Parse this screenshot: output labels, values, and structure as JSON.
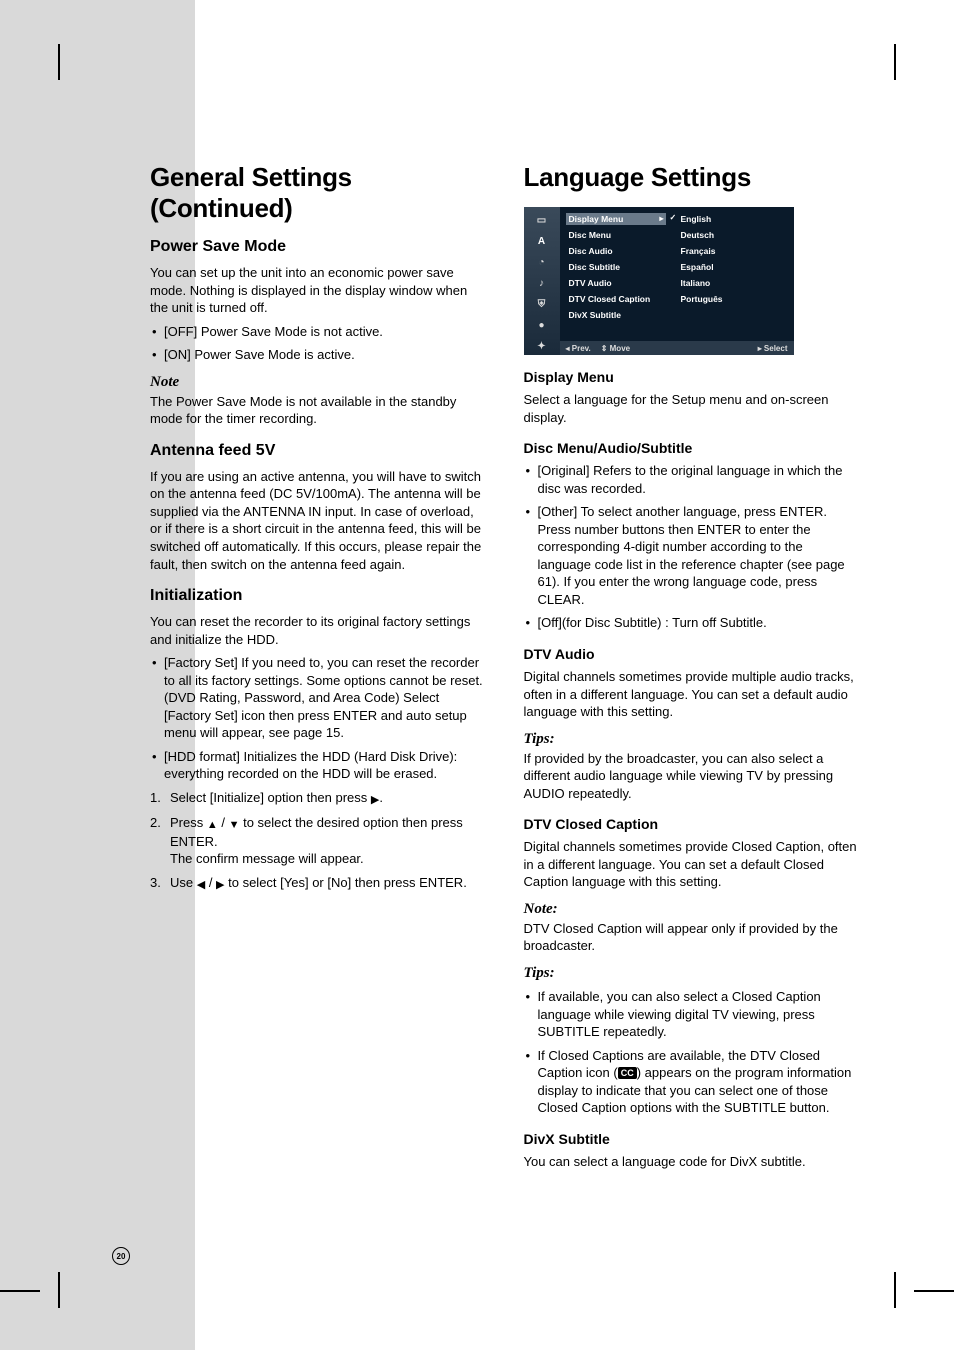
{
  "page_number": "20",
  "left": {
    "title": "General Settings (Continued)",
    "power_save": {
      "heading": "Power Save Mode",
      "intro": "You can set up the unit into an economic power save mode. Nothing is displayed in the display window when the unit is turned off.",
      "off": "[OFF] Power Save Mode is not active.",
      "on": "[ON] Power Save Mode is active.",
      "note_label": "Note",
      "note_body": "The Power Save Mode is not available in the standby mode for the timer recording."
    },
    "antenna": {
      "heading": "Antenna feed 5V",
      "body": "If you are using an active antenna, you will have to switch on the antenna feed (DC 5V/100mA). The antenna will be supplied via the ANTENNA IN input. In case of overload, or if there is a short circuit in the antenna feed, this will be switched off automatically. If this occurs, please repair the fault, then switch on the antenna feed again."
    },
    "init": {
      "heading": "Initialization",
      "intro": "You can reset the recorder to its original factory settings and initialize the HDD.",
      "factory": "[Factory Set] If you need to, you can reset the recorder to all its factory settings. Some options cannot be reset. (DVD Rating, Password, and Area Code) Select [Factory Set] icon then press ENTER and auto setup menu will appear, see page 15.",
      "hdd": "[HDD format] Initializes the HDD (Hard Disk Drive): everything recorded on the HDD will be erased.",
      "step1_pre": "Select [Initialize] option then press ",
      "step1_post": ".",
      "step2_pre": "Press ",
      "step2_mid": " / ",
      "step2_post": " to select the desired option then press ENTER.",
      "step2_line2": "The confirm message will appear.",
      "step3_pre": "Use ",
      "step3_mid": " / ",
      "step3_post": " to select [Yes] or [No] then press ENTER."
    }
  },
  "right": {
    "title": "Language Settings",
    "osd": {
      "menu": [
        "Display Menu",
        "Disc Menu",
        "Disc Audio",
        "Disc Subtitle",
        "DTV Audio",
        "DTV Closed Caption",
        "DivX Subtitle"
      ],
      "langs": [
        "English",
        "Deutsch",
        "Français",
        "Español",
        "Italiano",
        "Português"
      ],
      "footer_prev": "◂ Prev.",
      "footer_move": "⇕ Move",
      "footer_select": "▸ Select"
    },
    "display_menu": {
      "heading": "Display Menu",
      "body": "Select a language for the Setup menu and on-screen display."
    },
    "disc": {
      "heading": "Disc Menu/Audio/Subtitle",
      "original": "[Original] Refers to the original language in which the disc was recorded.",
      "other": "[Other] To select another language, press ENTER. Press number buttons then ENTER to enter the corresponding 4-digit number according to the language code list in the reference chapter (see page 61). If you enter the wrong language code, press CLEAR.",
      "off": "[Off](for Disc Subtitle) : Turn off Subtitle."
    },
    "dtv_audio": {
      "heading": "DTV Audio",
      "body": "Digital channels sometimes provide multiple audio tracks, often in a different language. You can set a default audio language with this setting.",
      "tips_label": "Tips:",
      "tips_body": "If provided by the broadcaster, you can also select a different audio language while viewing TV by pressing AUDIO repeatedly."
    },
    "dtv_cc": {
      "heading": "DTV Closed Caption",
      "body": "Digital channels sometimes provide Closed Caption, often in a different language. You can set a default Closed Caption language with this setting.",
      "note_label": "Note:",
      "note_body": "DTV Closed Caption will appear only if provided by the broadcaster.",
      "tips_label": "Tips:",
      "tip1": "If available, you can also select a Closed Caption language while viewing digital TV viewing, press SUBTITLE repeatedly.",
      "tip2_pre": "If Closed Captions are available, the DTV Closed Caption icon (",
      "tip2_cc": "CC",
      "tip2_post": ") appears on the program information display to indicate that you can select one of those Closed Caption options with the SUBTITLE button."
    },
    "divx": {
      "heading": "DivX Subtitle",
      "body": "You can select a language code for DivX subtitle."
    }
  }
}
